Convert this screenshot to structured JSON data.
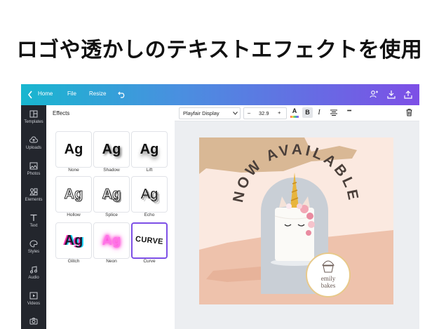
{
  "headline": "ロゴや透かしのテキストエフェクトを使用",
  "topbar": {
    "home_label": "Home",
    "file_label": "File",
    "resize_label": "Resize"
  },
  "sidebar": {
    "items": [
      {
        "label": "Templates",
        "icon": "templates-icon"
      },
      {
        "label": "Uploads",
        "icon": "upload-cloud-icon"
      },
      {
        "label": "Photos",
        "icon": "photo-icon"
      },
      {
        "label": "Elements",
        "icon": "elements-icon"
      },
      {
        "label": "Text",
        "icon": "text-icon"
      },
      {
        "label": "Styles",
        "icon": "palette-icon"
      },
      {
        "label": "Audio",
        "icon": "music-note-icon"
      },
      {
        "label": "Videos",
        "icon": "video-icon"
      },
      {
        "label": "",
        "icon": "camera-icon"
      }
    ]
  },
  "panel": {
    "title": "Effects",
    "effects": [
      {
        "sample": "Ag",
        "label": "None"
      },
      {
        "sample": "Ag",
        "label": "Shadow"
      },
      {
        "sample": "Ag",
        "label": "Lift"
      },
      {
        "sample": "Ag",
        "label": "Hollow"
      },
      {
        "sample": "Ag",
        "label": "Splice"
      },
      {
        "sample": "Ag",
        "label": "Echo"
      },
      {
        "sample": "Ag",
        "label": "Glitch"
      },
      {
        "sample": "Ag",
        "label": "Neon"
      },
      {
        "sample": "CURVE",
        "label": "Curve"
      }
    ],
    "selected": "Curve"
  },
  "toolbar": {
    "font_name": "Playfair Display",
    "minus": "–",
    "font_size": "32.9",
    "plus": "+",
    "color_letter": "A",
    "bold": "B",
    "italic": "I",
    "more": "•••"
  },
  "design": {
    "headline": "NOW AVAILABLE",
    "logo_line1": "emily",
    "logo_line2": "bakes"
  },
  "colors": {
    "accent": "#7d4fe6",
    "canvas_bg": "#fbe9e0",
    "tan": "#d9b895",
    "peach": "#eec2ac",
    "text_dark": "#4a3f3a"
  }
}
